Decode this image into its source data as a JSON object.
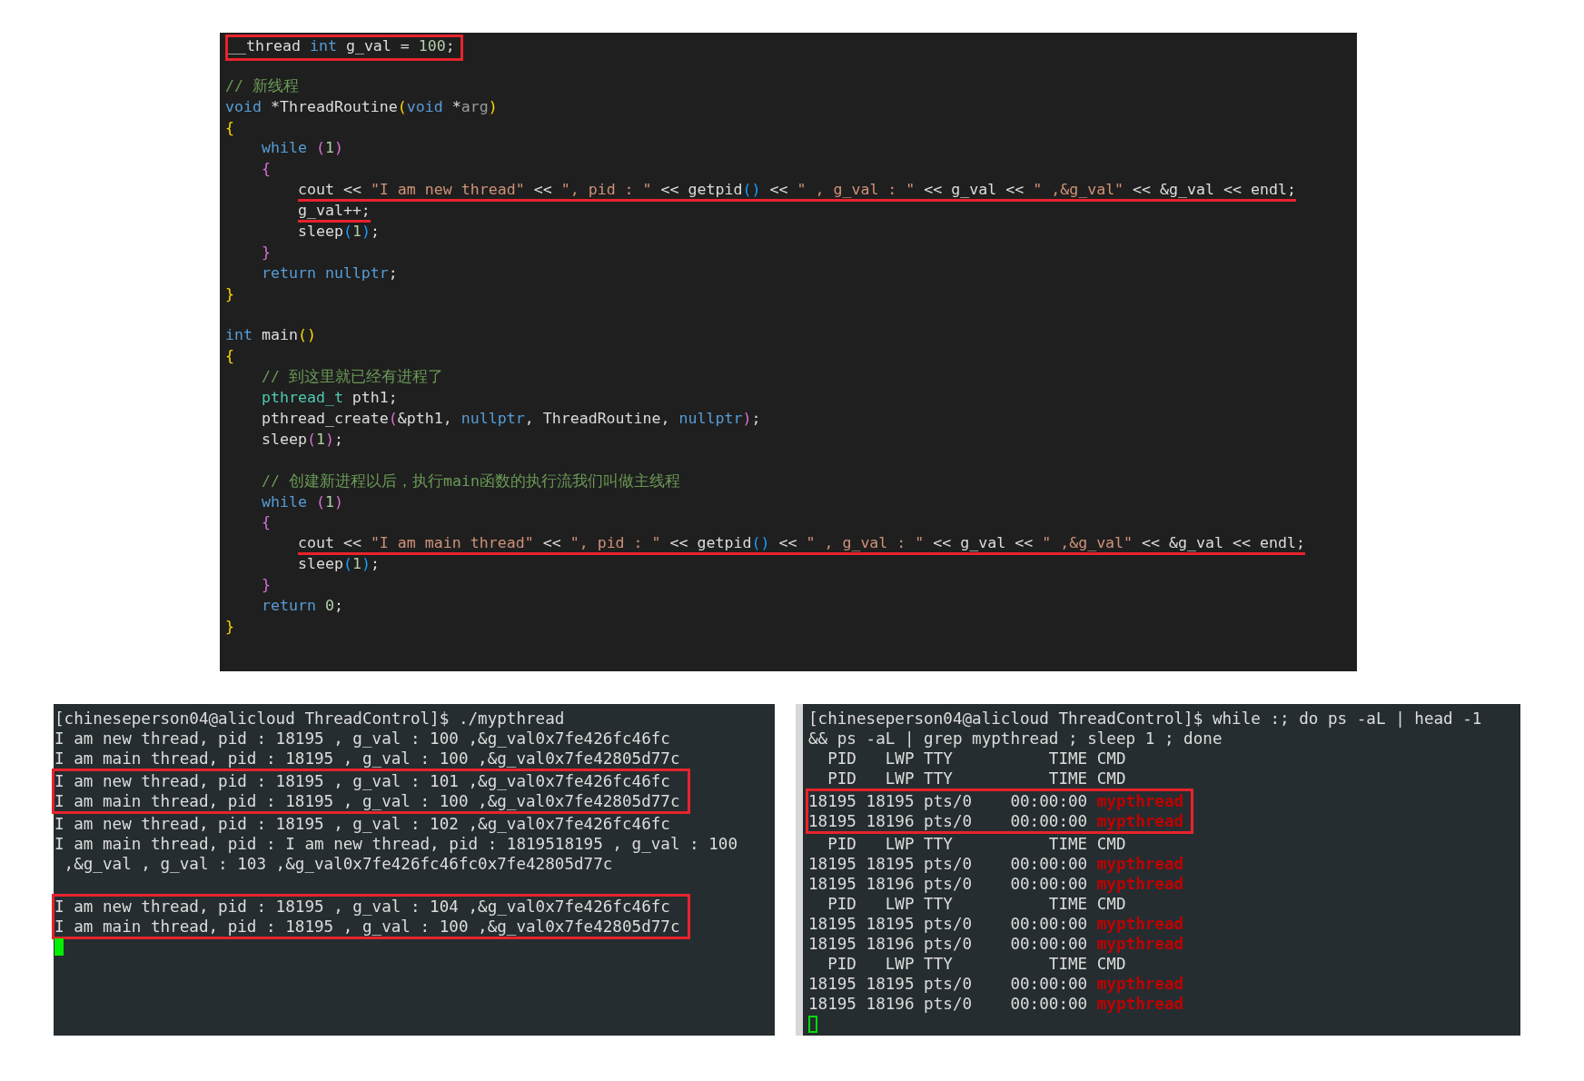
{
  "editor": {
    "lines": [
      {
        "kind": "boxed",
        "segments": [
          {
            "kind": "plain",
            "text": "__thread "
          },
          {
            "kind": "keyword",
            "text": "int"
          },
          {
            "kind": "plain",
            "text": " g_val = "
          },
          {
            "kind": "number",
            "text": "100"
          },
          {
            "kind": "plain",
            "text": ";"
          }
        ]
      },
      {
        "kind": "blank"
      },
      {
        "kind": "code",
        "segments": [
          {
            "kind": "comment",
            "text": "// 新线程"
          }
        ]
      },
      {
        "kind": "code",
        "segments": [
          {
            "kind": "keyword",
            "text": "void"
          },
          {
            "kind": "plain",
            "text": " *ThreadRoutine"
          },
          {
            "kind": "bracket1",
            "text": "("
          },
          {
            "kind": "keyword",
            "text": "void"
          },
          {
            "kind": "plain",
            "text": " *"
          },
          {
            "kind": "param",
            "text": "arg"
          },
          {
            "kind": "bracket1",
            "text": ")"
          }
        ]
      },
      {
        "kind": "code",
        "segments": [
          {
            "kind": "bracket1",
            "text": "{"
          }
        ]
      },
      {
        "kind": "code",
        "segments": [
          {
            "kind": "keyword",
            "text": "    while"
          },
          {
            "kind": "bracket2",
            "text": " ("
          },
          {
            "kind": "number",
            "text": "1"
          },
          {
            "kind": "bracket2",
            "text": ")"
          }
        ]
      },
      {
        "kind": "code",
        "segments": [
          {
            "kind": "bracket2",
            "text": "    {"
          }
        ]
      },
      {
        "kind": "underlined",
        "segments": [
          {
            "kind": "plain",
            "text": "        cout << "
          },
          {
            "kind": "string",
            "text": "\"I am new thread\""
          },
          {
            "kind": "plain",
            "text": " << "
          },
          {
            "kind": "string",
            "text": "\", pid : \""
          },
          {
            "kind": "plain",
            "text": " << getpid"
          },
          {
            "kind": "bracket3",
            "text": "()"
          },
          {
            "kind": "plain",
            "text": " << "
          },
          {
            "kind": "string",
            "text": "\" , g_val : \""
          },
          {
            "kind": "plain",
            "text": " << g_val << "
          },
          {
            "kind": "string",
            "text": "\" ,&g_val\""
          },
          {
            "kind": "plain",
            "text": " << &g_val << endl;"
          }
        ]
      },
      {
        "kind": "underlined",
        "segments": [
          {
            "kind": "plain",
            "text": "        g_val++;"
          }
        ]
      },
      {
        "kind": "code",
        "segments": [
          {
            "kind": "plain",
            "text": "        sleep"
          },
          {
            "kind": "bracket3",
            "text": "("
          },
          {
            "kind": "number",
            "text": "1"
          },
          {
            "kind": "bracket3",
            "text": ")"
          },
          {
            "kind": "plain",
            "text": ";"
          }
        ]
      },
      {
        "kind": "code",
        "segments": [
          {
            "kind": "bracket2",
            "text": "    }"
          }
        ]
      },
      {
        "kind": "code",
        "segments": [
          {
            "kind": "keyword",
            "text": "    return nullptr"
          },
          {
            "kind": "plain",
            "text": ";"
          }
        ]
      },
      {
        "kind": "code",
        "segments": [
          {
            "kind": "bracket1",
            "text": "}"
          }
        ]
      },
      {
        "kind": "blank"
      },
      {
        "kind": "code",
        "segments": [
          {
            "kind": "keyword",
            "text": "int"
          },
          {
            "kind": "plain",
            "text": " main"
          },
          {
            "kind": "bracket1",
            "text": "()"
          }
        ]
      },
      {
        "kind": "code",
        "segments": [
          {
            "kind": "bracket1",
            "text": "{"
          }
        ]
      },
      {
        "kind": "code",
        "segments": [
          {
            "kind": "comment",
            "text": "    // 到这里就已经有进程了"
          }
        ]
      },
      {
        "kind": "code",
        "segments": [
          {
            "kind": "type",
            "text": "    pthread_t"
          },
          {
            "kind": "plain",
            "text": " pth1;"
          }
        ]
      },
      {
        "kind": "code",
        "segments": [
          {
            "kind": "plain",
            "text": "    pthread_create"
          },
          {
            "kind": "bracket2",
            "text": "("
          },
          {
            "kind": "plain",
            "text": "&pth1, "
          },
          {
            "kind": "keyword",
            "text": "nullptr"
          },
          {
            "kind": "plain",
            "text": ", ThreadRoutine, "
          },
          {
            "kind": "keyword",
            "text": "nullptr"
          },
          {
            "kind": "bracket2",
            "text": ")"
          },
          {
            "kind": "plain",
            "text": ";"
          }
        ]
      },
      {
        "kind": "code",
        "segments": [
          {
            "kind": "plain",
            "text": "    sleep"
          },
          {
            "kind": "bracket2",
            "text": "("
          },
          {
            "kind": "number",
            "text": "1"
          },
          {
            "kind": "bracket2",
            "text": ")"
          },
          {
            "kind": "plain",
            "text": ";"
          }
        ]
      },
      {
        "kind": "blank"
      },
      {
        "kind": "code",
        "segments": [
          {
            "kind": "comment",
            "text": "    // 创建新进程以后，执行main函数的执行流我们叫做主线程"
          }
        ]
      },
      {
        "kind": "code",
        "segments": [
          {
            "kind": "keyword",
            "text": "    while"
          },
          {
            "kind": "bracket2",
            "text": " ("
          },
          {
            "kind": "number",
            "text": "1"
          },
          {
            "kind": "bracket2",
            "text": ")"
          }
        ]
      },
      {
        "kind": "code",
        "segments": [
          {
            "kind": "bracket2",
            "text": "    {"
          }
        ]
      },
      {
        "kind": "underlined",
        "segments": [
          {
            "kind": "plain",
            "text": "        cout << "
          },
          {
            "kind": "string",
            "text": "\"I am main thread\""
          },
          {
            "kind": "plain",
            "text": " << "
          },
          {
            "kind": "string",
            "text": "\", pid : \""
          },
          {
            "kind": "plain",
            "text": " << getpid"
          },
          {
            "kind": "bracket3",
            "text": "()"
          },
          {
            "kind": "plain",
            "text": " << "
          },
          {
            "kind": "string",
            "text": "\" , g_val : \""
          },
          {
            "kind": "plain",
            "text": " << g_val << "
          },
          {
            "kind": "string",
            "text": "\" ,&g_val\""
          },
          {
            "kind": "plain",
            "text": " << &g_val << endl;"
          }
        ]
      },
      {
        "kind": "code",
        "segments": [
          {
            "kind": "plain",
            "text": "        sleep"
          },
          {
            "kind": "bracket3",
            "text": "("
          },
          {
            "kind": "number",
            "text": "1"
          },
          {
            "kind": "bracket3",
            "text": ")"
          },
          {
            "kind": "plain",
            "text": ";"
          }
        ]
      },
      {
        "kind": "code",
        "segments": [
          {
            "kind": "bracket2",
            "text": "    }"
          }
        ]
      },
      {
        "kind": "code",
        "segments": [
          {
            "kind": "keyword",
            "text": "    return"
          },
          {
            "kind": "number",
            "text": " 0"
          },
          {
            "kind": "plain",
            "text": ";"
          }
        ]
      },
      {
        "kind": "code",
        "segments": [
          {
            "kind": "bracket1",
            "text": "}"
          }
        ]
      }
    ]
  },
  "terminals": [
    {
      "cursor": {
        "kind": "block"
      },
      "blocks": [
        {
          "boxed": false,
          "lines": [
            {
              "segments": [
                {
                  "kind": "plain",
                  "text": "[chineseperson04@alicloud ThreadControl]$ ./mypthread"
                }
              ]
            },
            {
              "segments": [
                {
                  "kind": "plain",
                  "text": "I am new thread, pid : 18195 , g_val : 100 ,&g_val0x7fe426fc46fc"
                }
              ]
            },
            {
              "segments": [
                {
                  "kind": "plain",
                  "text": "I am main thread, pid : 18195 , g_val : 100 ,&g_val0x7fe42805d77c"
                }
              ]
            }
          ]
        },
        {
          "boxed": true,
          "lines": [
            {
              "segments": [
                {
                  "kind": "plain",
                  "text": "I am new thread, pid : 18195 , g_val : 101 ,&g_val0x7fe426fc46fc"
                }
              ]
            },
            {
              "segments": [
                {
                  "kind": "plain",
                  "text": "I am main thread, pid : 18195 , g_val : 100 ,&g_val0x7fe42805d77c"
                }
              ]
            }
          ]
        },
        {
          "boxed": false,
          "lines": [
            {
              "segments": [
                {
                  "kind": "plain",
                  "text": "I am new thread, pid : 18195 , g_val : 102 ,&g_val0x7fe426fc46fc"
                }
              ]
            },
            {
              "segments": [
                {
                  "kind": "plain",
                  "text": "I am main thread, pid : I am new thread, pid : 1819518195 , g_val : 100"
                }
              ]
            },
            {
              "segments": [
                {
                  "kind": "plain",
                  "text": " ,&g_val , g_val : 103 ,&g_val0x7fe426fc46fc0x7fe42805d77c"
                }
              ]
            },
            {
              "kind": "blank"
            }
          ]
        },
        {
          "boxed": true,
          "lines": [
            {
              "segments": [
                {
                  "kind": "plain",
                  "text": "I am new thread, pid : 18195 , g_val : 104 ,&g_val0x7fe426fc46fc"
                }
              ]
            },
            {
              "segments": [
                {
                  "kind": "plain",
                  "text": "I am main thread, pid : 18195 , g_val : 100 ,&g_val0x7fe42805d77c"
                }
              ]
            }
          ]
        }
      ]
    },
    {
      "cursor": {
        "kind": "hollow"
      },
      "blocks": [
        {
          "boxed": false,
          "lines": [
            {
              "segments": [
                {
                  "kind": "plain",
                  "text": "[chineseperson04@alicloud ThreadControl]$ while :; do ps -aL | head -1"
                }
              ]
            },
            {
              "segments": [
                {
                  "kind": "plain",
                  "text": "&& ps -aL | grep mypthread ; sleep 1 ; done"
                }
              ]
            },
            {
              "segments": [
                {
                  "kind": "plain",
                  "text": "  PID   LWP TTY          TIME CMD"
                }
              ]
            },
            {
              "segments": [
                {
                  "kind": "plain",
                  "text": "  PID   LWP TTY          TIME CMD"
                }
              ]
            }
          ]
        },
        {
          "boxed": true,
          "lines": [
            {
              "segments": [
                {
                  "kind": "plain",
                  "text": "18195 18195 pts/0    00:00:00 "
                },
                {
                  "kind": "match",
                  "text": "mypthread"
                }
              ]
            },
            {
              "segments": [
                {
                  "kind": "plain",
                  "text": "18195 18196 pts/0    00:00:00 "
                },
                {
                  "kind": "match",
                  "text": "mypthread"
                }
              ]
            }
          ]
        },
        {
          "boxed": false,
          "lines": [
            {
              "segments": [
                {
                  "kind": "plain",
                  "text": "  PID   LWP TTY          TIME CMD"
                }
              ]
            },
            {
              "segments": [
                {
                  "kind": "plain",
                  "text": "18195 18195 pts/0    00:00:00 "
                },
                {
                  "kind": "match",
                  "text": "mypthread"
                }
              ]
            },
            {
              "segments": [
                {
                  "kind": "plain",
                  "text": "18195 18196 pts/0    00:00:00 "
                },
                {
                  "kind": "match",
                  "text": "mypthread"
                }
              ]
            },
            {
              "segments": [
                {
                  "kind": "plain",
                  "text": "  PID   LWP TTY          TIME CMD"
                }
              ]
            },
            {
              "segments": [
                {
                  "kind": "plain",
                  "text": "18195 18195 pts/0    00:00:00 "
                },
                {
                  "kind": "match",
                  "text": "mypthread"
                }
              ]
            },
            {
              "segments": [
                {
                  "kind": "plain",
                  "text": "18195 18196 pts/0    00:00:00 "
                },
                {
                  "kind": "match",
                  "text": "mypthread"
                }
              ]
            },
            {
              "segments": [
                {
                  "kind": "plain",
                  "text": "  PID   LWP TTY          TIME CMD"
                }
              ]
            },
            {
              "segments": [
                {
                  "kind": "plain",
                  "text": "18195 18195 pts/0    00:00:00 "
                },
                {
                  "kind": "match",
                  "text": "mypthread"
                }
              ]
            },
            {
              "segments": [
                {
                  "kind": "plain",
                  "text": "18195 18196 pts/0    00:00:00 "
                },
                {
                  "kind": "match",
                  "text": "mypthread"
                }
              ]
            }
          ]
        }
      ]
    }
  ]
}
